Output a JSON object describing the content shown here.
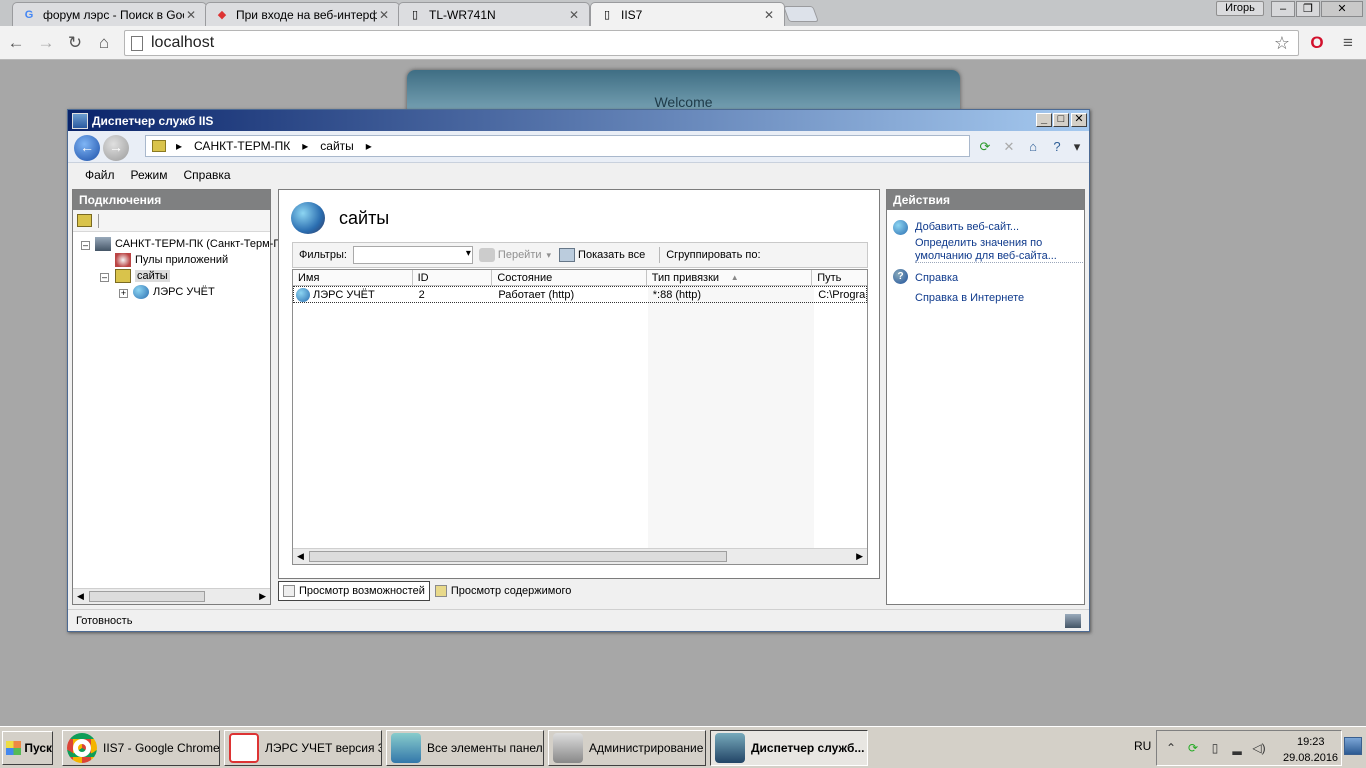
{
  "browser": {
    "tabs": [
      {
        "title": "форум лэрс - Поиск в Google",
        "favicon": "google-icon"
      },
      {
        "title": "При входе на веб-интерфейс",
        "favicon": "shield-icon"
      },
      {
        "title": "TL-WR741N",
        "favicon": "page-icon"
      },
      {
        "title": "IIS7",
        "favicon": "page-icon"
      }
    ],
    "user": "Игорь",
    "address": "localhost"
  },
  "webpage": {
    "welcome": "Welcome"
  },
  "iis": {
    "title": "Диспетчер служб IIS",
    "breadcrumb": [
      "САНКТ-ТЕРМ-ПК",
      "сайты"
    ],
    "menu": [
      "Файл",
      "Режим",
      "Справка"
    ],
    "connections": {
      "header": "Подключения",
      "tree": [
        {
          "label": "САНКТ-ТЕРМ-ПК (Санкт-Терм-П"
        },
        {
          "label": "Пулы приложений"
        },
        {
          "label": "сайты"
        },
        {
          "label": "ЛЭРС УЧЁТ"
        }
      ]
    },
    "center": {
      "title": "сайты",
      "filter_label": "Фильтры:",
      "go_label": "Перейти",
      "show_all_label": "Показать все",
      "group_label": "Сгруппировать по:",
      "columns": [
        "Имя",
        "ID",
        "Состояние",
        "Тип привязки",
        "Путь"
      ],
      "rows": [
        {
          "name": "ЛЭРС УЧЁТ",
          "id": "2",
          "state": "Работает (http)",
          "binding": "*:88 (http)",
          "path": "C:\\Progra"
        }
      ],
      "view_tabs": [
        "Просмотр возможностей",
        "Просмотр содержимого"
      ]
    },
    "actions": {
      "header": "Действия",
      "items": [
        {
          "label": "Добавить веб-сайт..."
        },
        {
          "label": "Определить значения по умолчанию для веб-сайта..."
        },
        {
          "label": "Справка"
        },
        {
          "label": "Справка в Интернете"
        }
      ]
    },
    "status": "Готовность"
  },
  "taskbar": {
    "start": "Пуск",
    "tasks": [
      {
        "label": "IIS7 - Google Chrome"
      },
      {
        "label": "ЛЭРС УЧЕТ версия 3..."
      },
      {
        "label": "Все элементы панел..."
      },
      {
        "label": "Администрирование"
      },
      {
        "label": "Диспетчер служб..."
      }
    ],
    "lang": "RU",
    "time": "19:23",
    "date": "29.08.2016"
  }
}
